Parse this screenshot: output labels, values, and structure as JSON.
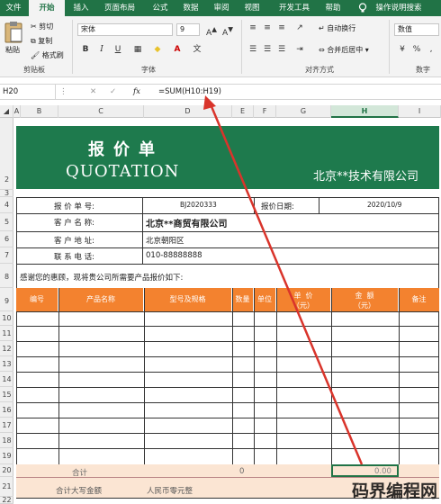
{
  "ribbon_tabs": [
    "文件",
    "开始",
    "插入",
    "页面布局",
    "公式",
    "数据",
    "审阅",
    "视图",
    "开发工具",
    "帮助",
    "操作说明搜索"
  ],
  "ribbon": {
    "paste": "粘贴",
    "cut": "剪切",
    "copy": "复制",
    "format_painter": "格式刷",
    "clipboard_group": "剪贴板",
    "font_name": "宋体",
    "font_size": "9",
    "font_group": "字体",
    "wrap_text": "自动换行",
    "merge_center": "合并后居中",
    "align_group": "对齐方式",
    "number_format": "数值",
    "number_group": "数字"
  },
  "formula_bar": {
    "name_box": "H20",
    "fx": "fx",
    "formula": "=SUM(H10:H19)"
  },
  "columns": [
    "A",
    "B",
    "C",
    "D",
    "E",
    "F",
    "G",
    "H",
    "I"
  ],
  "rows": [
    "2",
    "3",
    "4",
    "5",
    "6",
    "7",
    "8",
    "9",
    "10",
    "11",
    "12",
    "13",
    "14",
    "15",
    "16",
    "17",
    "18",
    "19",
    "20",
    "21",
    "22"
  ],
  "sheet": {
    "title_cn": "报价单",
    "title_en": "QUOTATION",
    "company": "北京**技术有限公司",
    "quote_no_label": "报 价 单 号:",
    "quote_no": "BJ2020333",
    "quote_date_label": "报价日期:",
    "quote_date": "2020/10/9",
    "customer_label": "客 户 名 称:",
    "customer": "北京**商贸有限公司",
    "address_label": "客 户 地 址:",
    "address": "北京朝阳区",
    "phone_label": "联 系 电 话:",
    "phone": "010-88888888",
    "intro": "感谢您的惠顾，现将贵公司所需要产品报价如下:",
    "headers": [
      "编号",
      "产品名称",
      "型号及规格",
      "数量",
      "单位",
      "单  价\n（元）",
      "金  额\n（元）",
      "备注"
    ],
    "total_label": "合计",
    "total_qty": "0",
    "total_amount": "0.00",
    "total_words_label": "合计大写金额",
    "total_words": "人民币零元整"
  },
  "watermark": "码界编程网",
  "colors": {
    "ribbon_green": "#217346",
    "title_green": "#1e7a4d",
    "header_orange": "#f3822f",
    "total_peach": "#fbe5d3",
    "arrow_red": "#d9342b"
  }
}
